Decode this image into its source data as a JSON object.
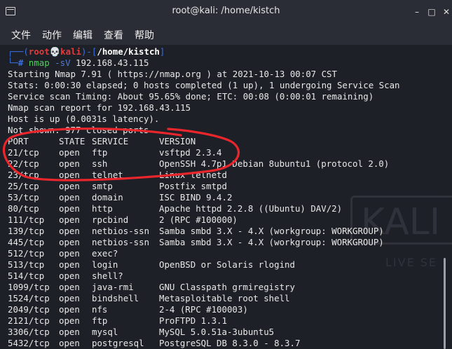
{
  "window": {
    "title": "root@kali: /home/kistch"
  },
  "menu": [
    "文件",
    "动作",
    "编辑",
    "查看",
    "帮助"
  ],
  "prompt": {
    "user": "root",
    "host": "kali",
    "path": "/home/kistch",
    "cmd": "nmap",
    "arg": "-sV",
    "ip": "192.168.43.115"
  },
  "output": {
    "line1": "Starting Nmap 7.91 ( https://nmap.org ) at 2021-10-13 00:07 CST",
    "line2": "Stats: 0:00:30 elapsed; 0 hosts completed (1 up), 1 undergoing Service Scan",
    "line3": "Service scan Timing: About 95.65% done; ETC: 00:08 (0:00:01 remaining)",
    "line4": "Nmap scan report for 192.168.43.115",
    "line5": "Host is up (0.0031s latency).",
    "line6": "Not shown: 977 closed ports"
  },
  "table": {
    "headers": [
      "PORT",
      "STATE",
      "SERVICE",
      "VERSION"
    ],
    "rows": [
      [
        "21/tcp",
        "open",
        "ftp",
        "vsftpd 2.3.4"
      ],
      [
        "22/tcp",
        "open",
        "ssh",
        "OpenSSH 4.7p1 Debian 8ubuntu1 (protocol 2.0)"
      ],
      [
        "23/tcp",
        "open",
        "telnet",
        "Linux telnetd"
      ],
      [
        "25/tcp",
        "open",
        "smtp",
        "Postfix smtpd"
      ],
      [
        "53/tcp",
        "open",
        "domain",
        "ISC BIND 9.4.2"
      ],
      [
        "80/tcp",
        "open",
        "http",
        "Apache httpd 2.2.8 ((Ubuntu) DAV/2)"
      ],
      [
        "111/tcp",
        "open",
        "rpcbind",
        "2 (RPC #100000)"
      ],
      [
        "139/tcp",
        "open",
        "netbios-ssn",
        "Samba smbd 3.X - 4.X (workgroup: WORKGROUP)"
      ],
      [
        "445/tcp",
        "open",
        "netbios-ssn",
        "Samba smbd 3.X - 4.X (workgroup: WORKGROUP)"
      ],
      [
        "512/tcp",
        "open",
        "exec?",
        ""
      ],
      [
        "513/tcp",
        "open",
        "login",
        "OpenBSD or Solaris rlogind"
      ],
      [
        "514/tcp",
        "open",
        "shell?",
        ""
      ],
      [
        "1099/tcp",
        "open",
        "java-rmi",
        "GNU Classpath grmiregistry"
      ],
      [
        "1524/tcp",
        "open",
        "bindshell",
        "Metasploitable root shell"
      ],
      [
        "2049/tcp",
        "open",
        "nfs",
        "2-4 (RPC #100003)"
      ],
      [
        "2121/tcp",
        "open",
        "ftp",
        "ProFTPD 1.3.1"
      ],
      [
        "3306/tcp",
        "open",
        "mysql",
        "MySQL 5.0.51a-3ubuntu5"
      ],
      [
        "5432/tcp",
        "open",
        "postgresql",
        "PostgreSQL DB 8.3.0 - 8.3.7"
      ]
    ]
  },
  "watermark": {
    "logo": "KALI",
    "tagline": "LIVE SE"
  },
  "colors": {
    "annotation": "#e8262b",
    "prompt_blue": "#3b6fe0",
    "prompt_red": "#e23b3b",
    "cmd_green": "#4fd15a"
  }
}
